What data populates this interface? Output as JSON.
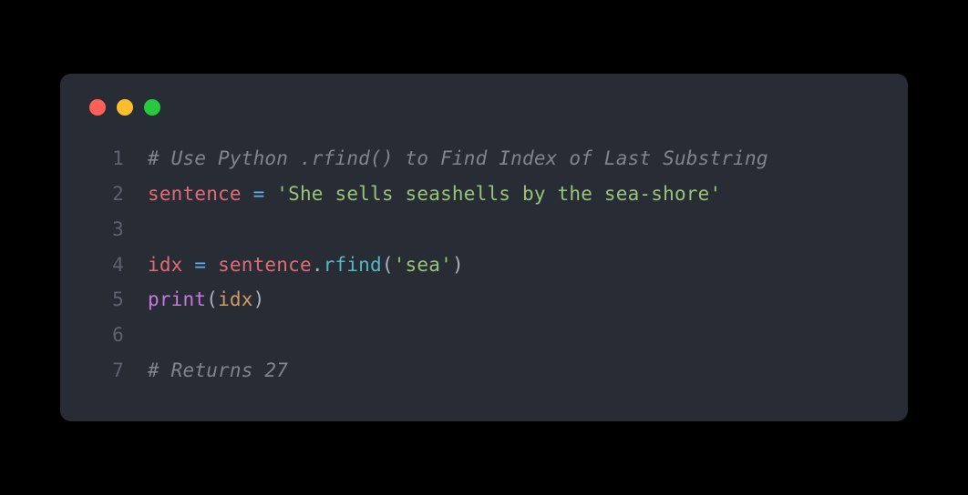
{
  "window": {
    "controls": [
      "close",
      "minimize",
      "maximize"
    ]
  },
  "code": {
    "lines": [
      {
        "num": "1",
        "tokens": [
          {
            "cls": "tok-comment",
            "text": "# Use Python .rfind() to Find Index of Last Substring"
          }
        ]
      },
      {
        "num": "2",
        "tokens": [
          {
            "cls": "tok-variable",
            "text": "sentence"
          },
          {
            "cls": "tok-default",
            "text": " "
          },
          {
            "cls": "tok-operator",
            "text": "="
          },
          {
            "cls": "tok-default",
            "text": " "
          },
          {
            "cls": "tok-string",
            "text": "'She sells seashells by the sea-shore'"
          }
        ]
      },
      {
        "num": "3",
        "tokens": []
      },
      {
        "num": "4",
        "tokens": [
          {
            "cls": "tok-variable",
            "text": "idx"
          },
          {
            "cls": "tok-default",
            "text": " "
          },
          {
            "cls": "tok-operator",
            "text": "="
          },
          {
            "cls": "tok-default",
            "text": " "
          },
          {
            "cls": "tok-variable",
            "text": "sentence"
          },
          {
            "cls": "tok-default",
            "text": "."
          },
          {
            "cls": "tok-method",
            "text": "rfind"
          },
          {
            "cls": "tok-default",
            "text": "("
          },
          {
            "cls": "tok-string",
            "text": "'sea'"
          },
          {
            "cls": "tok-default",
            "text": ")"
          }
        ]
      },
      {
        "num": "5",
        "tokens": [
          {
            "cls": "tok-builtin",
            "text": "print"
          },
          {
            "cls": "tok-default",
            "text": "("
          },
          {
            "cls": "tok-param",
            "text": "idx"
          },
          {
            "cls": "tok-default",
            "text": ")"
          }
        ]
      },
      {
        "num": "6",
        "tokens": []
      },
      {
        "num": "7",
        "tokens": [
          {
            "cls": "tok-comment",
            "text": "# Returns 27"
          }
        ]
      }
    ]
  }
}
